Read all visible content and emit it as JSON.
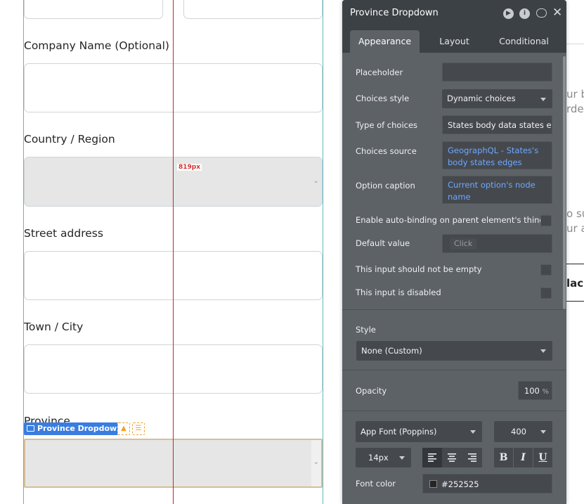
{
  "canvas": {
    "labels": {
      "company": "Company Name (Optional)",
      "country": "Country / Region",
      "street": "Street address",
      "town": "Town / City",
      "province": "Province"
    },
    "width_indicator": "819px",
    "selected_tag": "Province Dropdown",
    "right_text": [
      "ur b",
      "rder",
      "o sup",
      "ur a",
      "lac"
    ]
  },
  "panel": {
    "title": "Province Dropdown",
    "tabs": [
      "Appearance",
      "Layout",
      "Conditional"
    ],
    "active_tab": "Appearance",
    "fields": {
      "placeholder_label": "Placeholder",
      "placeholder_value": "",
      "choices_style_label": "Choices style",
      "choices_style_value": "Dynamic choices",
      "type_label": "Type of choices",
      "type_value": "States body data states edge",
      "source_label": "Choices source",
      "source_value": "GeographQL - States's body states edges",
      "caption_label": "Option caption",
      "caption_value": "Current option's node name",
      "autobinding_label": "Enable auto-binding on parent element's thing",
      "default_label": "Default value",
      "default_placeholder": "Click",
      "not_empty_label": "This input should not be empty",
      "disabled_label": "This input is disabled"
    },
    "style": {
      "label": "Style",
      "value": "None (Custom)",
      "opacity_label": "Opacity",
      "opacity_value": "100",
      "opacity_unit": "%",
      "font_family": "App Font (Poppins)",
      "font_weight": "400",
      "font_size": "14px",
      "bold": "B",
      "italic": "I",
      "underline": "U",
      "font_color_label": "Font color",
      "font_color_value": "#252525"
    }
  },
  "colors": {
    "guide_red": "#c62828",
    "guide_teal": "#5fb8c4",
    "accent_blue": "#3a7de0",
    "panel_bg": "#5d6267",
    "dynamic_blue": "#6ea7ff"
  }
}
